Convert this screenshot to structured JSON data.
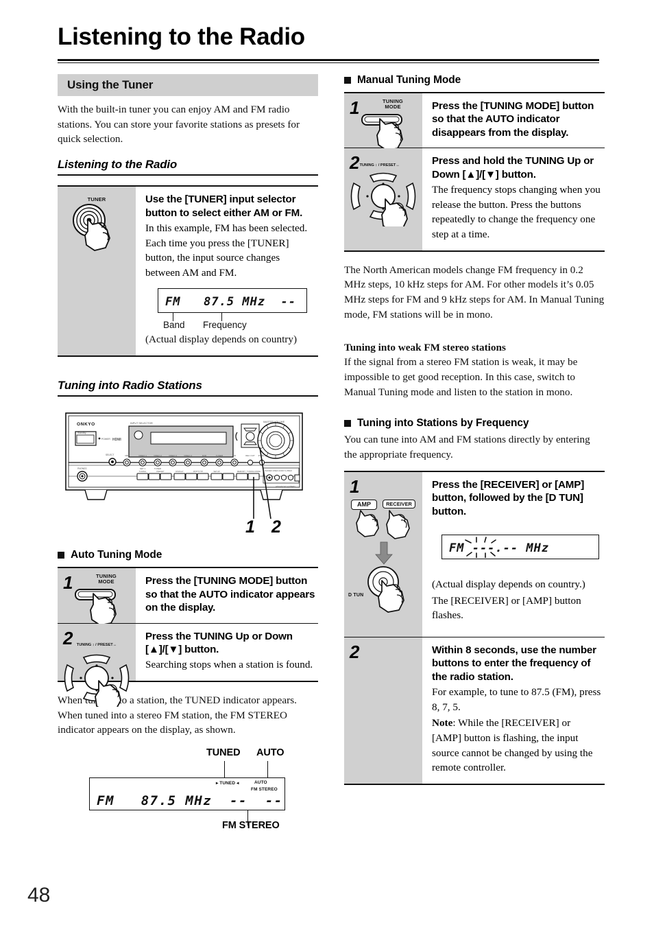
{
  "document": {
    "page_number": "48",
    "title": "Listening to the Radio"
  },
  "left_column": {
    "section_bar": "Using the Tuner",
    "intro": "With the built-in tuner you can enjoy AM and FM radio stations. You can store your favorite stations as presets for quick selection.",
    "subheading": "Listening to the Radio",
    "tuner_step": {
      "button_label": "TUNER",
      "bold": "Use the [TUNER] input selector button to select either AM or FM.",
      "desc": "In this example, FM has been selected. Each time you press the [TUNER] button, the input source changes between AM and FM.",
      "lcd": "FM   87.5 MHz  --",
      "tick_band": "Band",
      "tick_frequency": "Frequency",
      "footnote": "(Actual display depends on country)"
    },
    "tuning_subheading": "Tuning into Radio Stations",
    "receiver": {
      "brand": "ONKYO",
      "callout_1": "1",
      "callout_2": "2"
    },
    "auto_tuning": {
      "heading": "Auto Tuning Mode",
      "steps": [
        {
          "num": "1",
          "icon_label": "TUNING\nMODE",
          "bold": "Press the [TUNING MODE] button so that the AUTO indicator appears on the display.",
          "desc": ""
        },
        {
          "num": "2",
          "icon_label": "TUNING ↕ / PRESET↔",
          "bold": "Press the TUNING Up or Down [▲]/[▼] button.",
          "desc": "Searching stops when a station is found."
        }
      ]
    },
    "tuned_text": "When tuned into a station, the TUNED indicator appears. When tuned into a stereo FM station, the FM STEREO indicator appears on the display, as shown.",
    "tuned_display": {
      "callout_tuned": "TUNED",
      "callout_auto": "AUTO",
      "callout_fm_stereo": "FM STEREO",
      "ind_tuned": "▸ TUNED ◂",
      "ind_auto": "AUTO",
      "ind_fm_stereo": "FM STEREO",
      "lcd": "FM   87.5 MHz  --  --"
    }
  },
  "right_column": {
    "manual_tuning": {
      "heading": "Manual Tuning Mode",
      "steps": [
        {
          "num": "1",
          "icon_label": "TUNING\nMODE",
          "bold": "Press the [TUNING MODE] button so that the AUTO indicator disappears from the display.",
          "desc": ""
        },
        {
          "num": "2",
          "icon_label": "TUNING ↕ / PRESET↔",
          "bold": "Press and hold the TUNING Up or Down [▲]/[▼] button.",
          "desc": "The frequency stops changing when you release the button. Press the buttons repeatedly to change the frequency one step at a time."
        }
      ]
    },
    "steps_note": "The North American models change FM frequency in 0.2 MHz steps, 10 kHz steps for AM. For other models it’s 0.05 MHz steps for FM and 9 kHz steps for AM. In Manual Tuning mode, FM stations will be in mono.",
    "weak_fm": {
      "heading": "Tuning into weak FM stereo stations",
      "body": "If the signal from a stereo FM station is weak, it may be impossible to get good reception. In this case, switch to Manual Tuning mode and listen to the station in mono."
    },
    "by_frequency": {
      "heading": "Tuning into Stations by Frequency",
      "intro": "You can tune into AM and FM stations directly by entering the appropriate frequency.",
      "steps": [
        {
          "num": "1",
          "key_amp": "AMP",
          "key_receiver": "RECEIVER",
          "key_dtun": "D TUN",
          "bold": "Press the [RECEIVER] or [AMP] button, followed by the [D TUN] button.",
          "lcd": "FM ---.-- MHz",
          "desc_1": "(Actual display depends on country.)",
          "desc_2": "The [RECEIVER] or [AMP] button flashes."
        },
        {
          "num": "2",
          "bold": "Within 8 seconds, use the number buttons to enter the frequency of the radio station.",
          "desc_1": "For example, to tune to 87.5 (FM), press 8, 7, 5.",
          "note_label": "Note",
          "desc_2": ": While the [RECEIVER] or [AMP] button is flashing, the input source cannot be changed by using the remote controller."
        }
      ]
    }
  },
  "colors": {
    "gray_bar": "#cfcfcf",
    "gray_cell": "#d0d0d0",
    "ink": "#111111"
  }
}
